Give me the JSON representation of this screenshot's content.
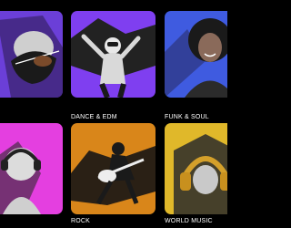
{
  "genres": [
    {
      "label": "",
      "bg": "#6b3fd8",
      "shape": "#2a1a4a",
      "art": "violin-player-icon"
    },
    {
      "label": "DANCE & EDM",
      "bg": "#7f3ff0",
      "shape": "#222222",
      "art": "dancer-icon"
    },
    {
      "label": "FUNK & SOUL",
      "bg": "#3f5be0",
      "shape": "#2a2f6a",
      "art": "singer-portrait-icon"
    },
    {
      "label": "",
      "bg": "#e43fe0",
      "shape": "#3a2a3a",
      "art": "headphones-listener-icon"
    },
    {
      "label": "ROCK",
      "bg": "#d9861a",
      "shape": "#2a2015",
      "art": "guitarist-icon"
    },
    {
      "label": "WORLD MUSIC",
      "bg": "#e0b82a",
      "shape": "#2a2a2a",
      "art": "gold-headphones-icon"
    }
  ]
}
